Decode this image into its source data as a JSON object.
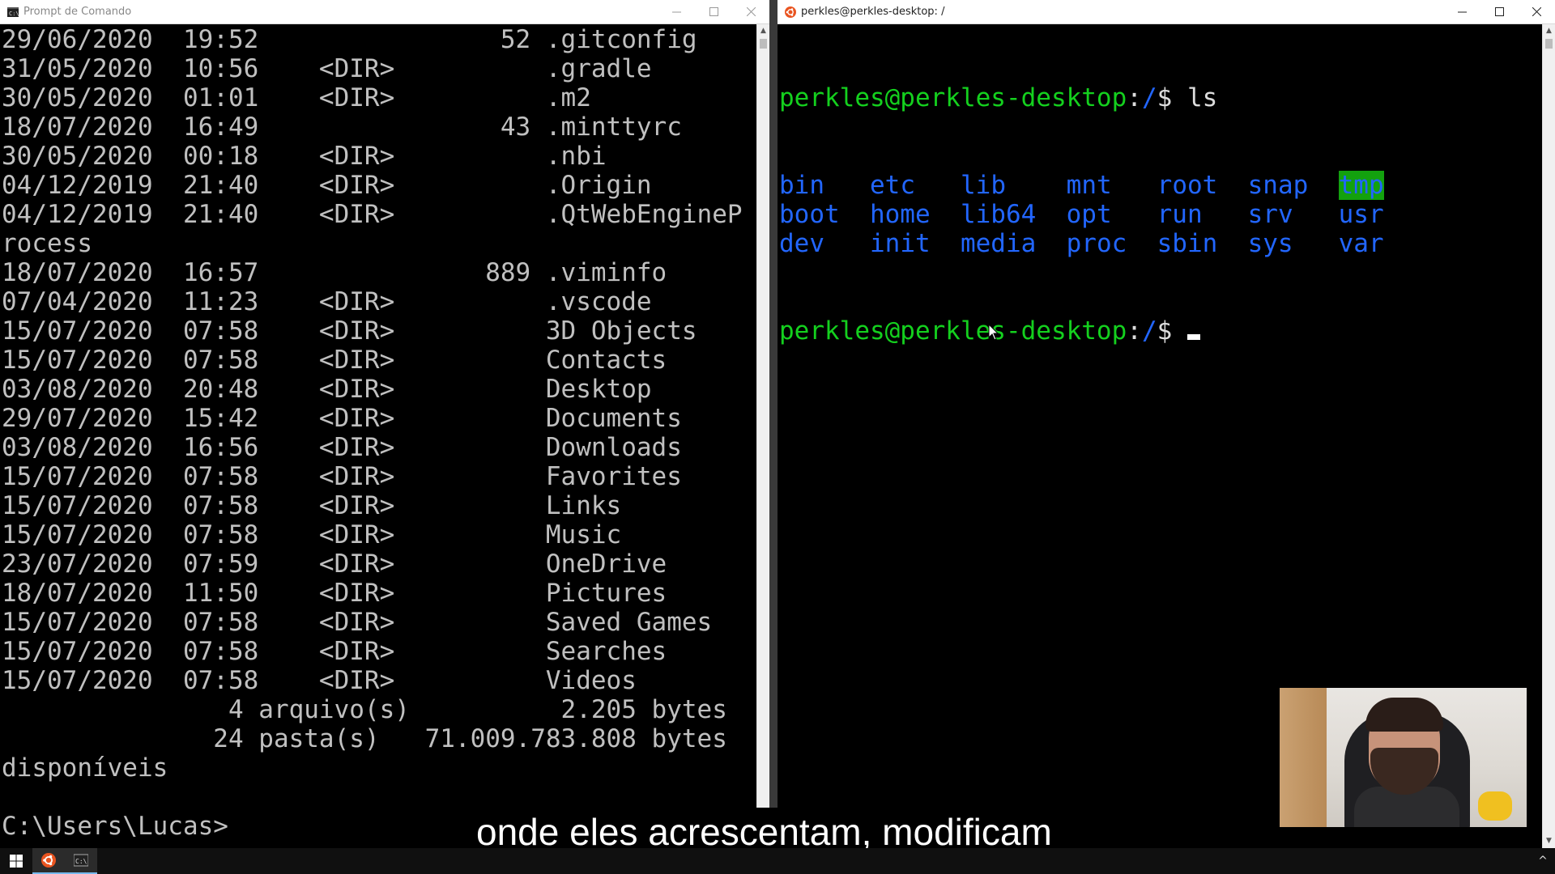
{
  "windows": {
    "cmd": {
      "title": "Prompt de Comando",
      "lines": [
        "29/06/2020  19:52                52 .gitconfig",
        "31/05/2020  10:56    <DIR>          .gradle",
        "30/05/2020  01:01    <DIR>          .m2",
        "18/07/2020  16:49                43 .minttyrc",
        "30/05/2020  00:18    <DIR>          .nbi",
        "04/12/2019  21:40    <DIR>          .Origin",
        "04/12/2019  21:40    <DIR>          .QtWebEngineP",
        "rocess",
        "18/07/2020  16:57               889 .viminfo",
        "07/04/2020  11:23    <DIR>          .vscode",
        "15/07/2020  07:58    <DIR>          3D Objects",
        "15/07/2020  07:58    <DIR>          Contacts",
        "03/08/2020  20:48    <DIR>          Desktop",
        "29/07/2020  15:42    <DIR>          Documents",
        "03/08/2020  16:56    <DIR>          Downloads",
        "15/07/2020  07:58    <DIR>          Favorites",
        "15/07/2020  07:58    <DIR>          Links",
        "15/07/2020  07:58    <DIR>          Music",
        "23/07/2020  07:59    <DIR>          OneDrive",
        "18/07/2020  11:50    <DIR>          Pictures",
        "15/07/2020  07:58    <DIR>          Saved Games",
        "15/07/2020  07:58    <DIR>          Searches",
        "15/07/2020  07:58    <DIR>          Videos",
        "               4 arquivo(s)          2.205 bytes",
        "              24 pasta(s)   71.009.783.808 bytes",
        "disponíveis",
        "",
        "C:\\Users\\Lucas>"
      ]
    },
    "wsl": {
      "title": "perkles@perkles-desktop: /",
      "prompt_user": "perkles@perkles-desktop",
      "prompt_sep": ":",
      "prompt_path": "/",
      "prompt_sym": "$",
      "command": "ls",
      "ls_rows": [
        [
          "bin",
          "etc",
          "lib",
          "mnt",
          "root",
          "snap",
          "tmp"
        ],
        [
          "boot",
          "home",
          "lib64",
          "opt",
          "run",
          "srv",
          "usr"
        ],
        [
          "dev",
          "init",
          "media",
          "proc",
          "sbin",
          "sys",
          "var"
        ]
      ],
      "highlighted_entry": "tmp"
    }
  },
  "subtitle": "onde eles acrescentam, modificam",
  "colors": {
    "prompt_green": "#14d01e",
    "dir_blue": "#2266ff",
    "highlight_bg": "#13a10e",
    "terminal_bg": "#000000"
  },
  "icons": {
    "cmd_title": "cmd-icon",
    "wsl_title": "ubuntu-icon",
    "taskbar": [
      "windows-start-icon",
      "ubuntu-icon",
      "cmd-icon"
    ],
    "tray": "chevron-up-icon"
  }
}
